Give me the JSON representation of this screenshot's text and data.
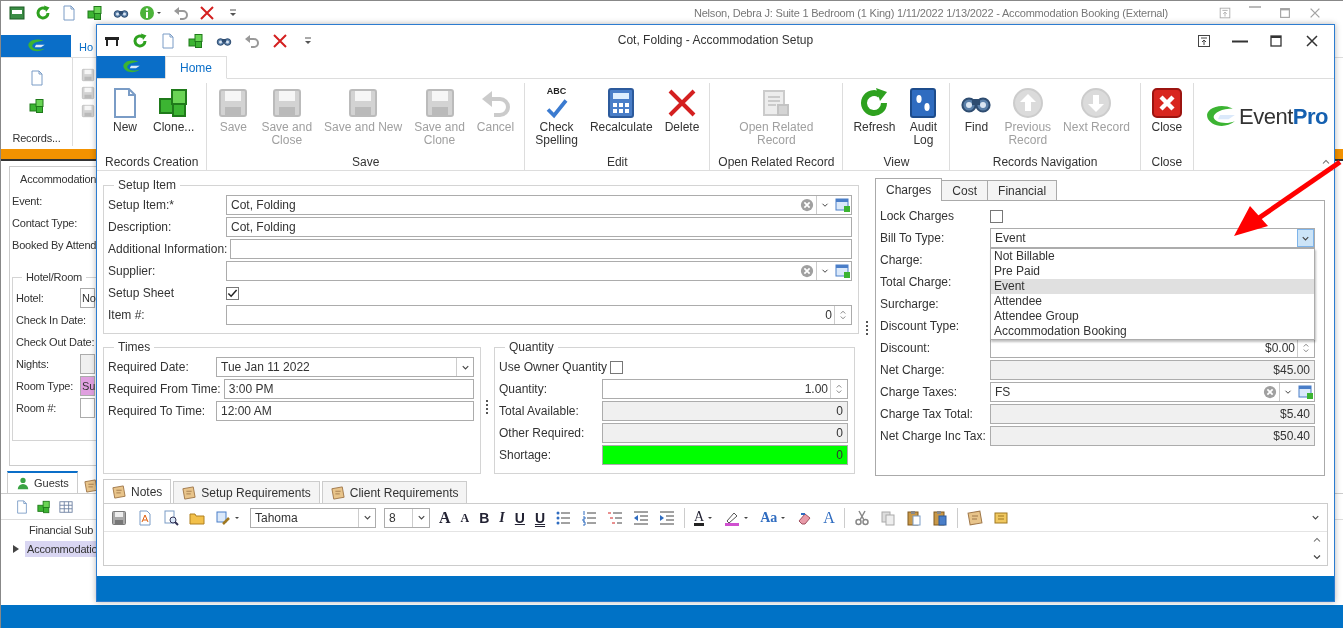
{
  "background_window": {
    "title": "Nelson, Debra J: Suite 1 Bedroom (1 King) 1/11/2022 1/13/2022  - Accommodation Booking (External)",
    "quick_access": [
      {
        "kind": "booking"
      },
      {
        "kind": "refresh"
      },
      {
        "kind": "new"
      },
      {
        "kind": "clone"
      },
      {
        "kind": "find"
      },
      {
        "kind": "info",
        "menu": true
      },
      {
        "kind": "undo"
      },
      {
        "kind": "delete"
      },
      {
        "kind": "more"
      }
    ],
    "ribbon_tab": "Ho",
    "ribbon_group": "Records...",
    "panel_title": "Accommodation",
    "fields": [
      {
        "label": "Event:"
      },
      {
        "label": "Contact Type:"
      },
      {
        "label": "Booked By Attend"
      }
    ],
    "hotel_group": {
      "title": "Hotel/Room",
      "fields": [
        {
          "label": "Hotel:",
          "kind": "text",
          "value": "No"
        },
        {
          "label": "Check In Date:",
          "kind": "none"
        },
        {
          "label": "Check Out Date:",
          "kind": "none"
        },
        {
          "label": "Nights:",
          "kind": "readonly"
        },
        {
          "label": "Room Type:",
          "kind": "color",
          "value": "Su",
          "color": "#e0a0e0"
        },
        {
          "label": "Room #:",
          "kind": "text"
        }
      ]
    },
    "tabs": [
      {
        "label": "Guests",
        "selected": true
      }
    ],
    "grid": {
      "columns": [
        "Financial Sub"
      ],
      "rows": [
        {
          "cells": [
            "Accommodatio"
          ],
          "selected": true
        }
      ]
    }
  },
  "dialog": {
    "title": "Cot, Folding - Accommodation Setup",
    "quick_access": [
      {
        "kind": "table"
      },
      {
        "kind": "refresh"
      },
      {
        "kind": "new"
      },
      {
        "kind": "clone"
      },
      {
        "kind": "find"
      },
      {
        "kind": "undo"
      },
      {
        "kind": "delete"
      },
      {
        "kind": "more"
      }
    ],
    "ribbon_tab": "Home",
    "ribbon_groups": [
      {
        "label": "Records Creation",
        "buttons": [
          {
            "label": "New",
            "kind": "new",
            "disabled": false
          },
          {
            "label": "Clone...",
            "kind": "clone",
            "disabled": false
          }
        ]
      },
      {
        "label": "Save",
        "buttons": [
          {
            "label": "Save",
            "kind": "save",
            "disabled": true
          },
          {
            "label": "Save and\nClose",
            "kind": "save",
            "disabled": true
          },
          {
            "label": "Save and New",
            "kind": "save",
            "disabled": true
          },
          {
            "label": "Save and\nClone",
            "kind": "save",
            "disabled": true
          },
          {
            "label": "Cancel",
            "kind": "undo",
            "disabled": true
          }
        ]
      },
      {
        "label": "Edit",
        "buttons": [
          {
            "label": "Check\nSpelling",
            "kind": "spell",
            "icon_text": "ABC",
            "disabled": false
          },
          {
            "label": "Recalculate",
            "kind": "calc",
            "disabled": false
          },
          {
            "label": "Delete",
            "kind": "delete",
            "disabled": false
          }
        ]
      },
      {
        "label": "Open Related Record",
        "buttons": [
          {
            "label": "Open Related\nRecord",
            "kind": "related",
            "disabled": true
          }
        ]
      },
      {
        "label": "View",
        "buttons": [
          {
            "label": "Refresh",
            "kind": "refresh",
            "disabled": false
          },
          {
            "label": "Audit\nLog",
            "kind": "log",
            "disabled": false
          }
        ]
      },
      {
        "label": "Records Navigation",
        "buttons": [
          {
            "label": "Find",
            "kind": "find",
            "disabled": false
          },
          {
            "label": "Previous\nRecord",
            "kind": "prev",
            "disabled": true
          },
          {
            "label": "Next Record",
            "kind": "next",
            "disabled": true
          }
        ]
      },
      {
        "label": "Close",
        "buttons": [
          {
            "label": "Close",
            "kind": "close",
            "disabled": false
          }
        ]
      }
    ],
    "logo": "Event**Pro**",
    "setup_item": {
      "title": "Setup Item",
      "fields": [
        {
          "label": "Setup Item:*",
          "kind": "lookup",
          "value": "Cot, Folding"
        },
        {
          "label": "Description:",
          "kind": "text",
          "value": "Cot, Folding"
        },
        {
          "label": "Additional Information:",
          "kind": "text"
        },
        {
          "label": "Supplier:",
          "kind": "lookup"
        },
        {
          "label": "Setup Sheet",
          "kind": "check",
          "checked": true
        },
        {
          "label": "Item #:",
          "kind": "spin",
          "value": "0"
        }
      ]
    },
    "times": {
      "title": "Times",
      "fields": [
        {
          "label": "Required Date:",
          "kind": "dropdown",
          "value": "Tue Jan 11 2022",
          "expanded": false
        },
        {
          "label": "Required From Time:",
          "kind": "text",
          "value": "3:00 PM"
        },
        {
          "label": "Required To Time:",
          "kind": "text",
          "value": "12:00 AM"
        }
      ]
    },
    "quantity": {
      "title": "Quantity",
      "fields": [
        {
          "label": "Use Owner Quantity",
          "kind": "check",
          "checked": false
        },
        {
          "label": "Quantity:",
          "kind": "spin",
          "value": "1.00"
        },
        {
          "label": "Total Available:",
          "kind": "readonly",
          "value": "0"
        },
        {
          "label": "Other Required:",
          "kind": "readonly",
          "value": "0"
        },
        {
          "label": "Shortage:",
          "kind": "status",
          "value": "0",
          "color": "#00ff00"
        }
      ]
    },
    "charges": {
      "tabs": [
        {
          "label": "Charges",
          "selected": true
        },
        {
          "label": "Cost",
          "selected": false
        },
        {
          "label": "Financial",
          "selected": false
        }
      ],
      "fields": [
        {
          "label": "Lock Charges",
          "kind": "check",
          "checked": false
        },
        {
          "label": "Bill To Type:",
          "kind": "dropdown",
          "value": "Event",
          "expanded": true,
          "options": [
            {
              "label": "Not Billable",
              "selected": false
            },
            {
              "label": "Pre Paid",
              "selected": false
            },
            {
              "label": "Event",
              "selected": true
            },
            {
              "label": "Attendee",
              "selected": false
            },
            {
              "label": "Attendee Group",
              "selected": false
            },
            {
              "label": "Accommodation Booking",
              "selected": false
            }
          ]
        },
        {
          "label": "Charge:",
          "kind": "none"
        },
        {
          "label": "Total Charge:",
          "kind": "none"
        },
        {
          "label": "Surcharge:",
          "kind": "none"
        },
        {
          "label": "Discount Type:",
          "kind": "none"
        },
        {
          "label": "Discount:",
          "kind": "spin",
          "value": "$0.00"
        },
        {
          "label": "Net Charge:",
          "kind": "readonly",
          "value": "$45.00"
        },
        {
          "label": "Charge Taxes:",
          "kind": "lookup",
          "value": "FS"
        },
        {
          "label": "Charge Tax Total:",
          "kind": "readonly",
          "value": "$5.40"
        },
        {
          "label": "Net Charge Inc Tax:",
          "kind": "readonly",
          "value": "$50.40"
        }
      ]
    },
    "notes": {
      "tabs": [
        {
          "label": "Notes",
          "selected": true
        },
        {
          "label": "Setup Requirements",
          "selected": false
        },
        {
          "label": "Client Requirements",
          "selected": false
        }
      ],
      "toolbar": [
        {
          "kind": "save"
        },
        {
          "kind": "doc"
        },
        {
          "kind": "preview"
        },
        {
          "kind": "open"
        },
        {
          "kind": "style",
          "menu": true
        },
        {
          "kind": "fontname",
          "value": "Tahoma"
        },
        {
          "kind": "fontsize",
          "value": "8"
        },
        {
          "kind": "grow",
          "text": "A"
        },
        {
          "kind": "shrink",
          "text": "A"
        },
        {
          "kind": "bold",
          "text": "B"
        },
        {
          "kind": "italic",
          "text": "I"
        },
        {
          "kind": "underline",
          "text": "U"
        },
        {
          "kind": "double",
          "text": "U"
        },
        {
          "kind": "bullets"
        },
        {
          "kind": "numbers"
        },
        {
          "kind": "multilevel"
        },
        {
          "kind": "outdent"
        },
        {
          "kind": "indent"
        },
        {
          "kind": "sep"
        },
        {
          "kind": "fontcolor",
          "text": "A",
          "menu": true
        },
        {
          "kind": "highlight",
          "menu": true
        },
        {
          "kind": "case",
          "text": "Aa",
          "menu": true
        },
        {
          "kind": "clear"
        },
        {
          "kind": "font",
          "text": "A"
        },
        {
          "kind": "sep"
        },
        {
          "kind": "cut"
        },
        {
          "kind": "copy"
        },
        {
          "kind": "paste"
        },
        {
          "kind": "pastespecial"
        },
        {
          "kind": "sep"
        },
        {
          "kind": "note"
        },
        {
          "kind": "note2"
        }
      ]
    }
  },
  "annotation": {
    "kind": "arrow"
  }
}
